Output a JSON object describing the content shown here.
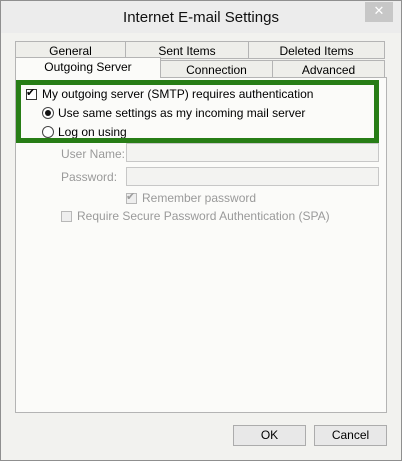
{
  "window": {
    "title": "Internet E-mail Settings"
  },
  "tabs": {
    "row_back": [
      {
        "label": "General"
      },
      {
        "label": "Sent Items"
      },
      {
        "label": "Deleted Items"
      }
    ],
    "row_front": [
      {
        "label": "Outgoing Server",
        "active": true
      },
      {
        "label": "Connection"
      },
      {
        "label": "Advanced"
      }
    ]
  },
  "outgoing": {
    "smtp_auth": {
      "label": "My outgoing server (SMTP) requires authentication",
      "checked": true
    },
    "same_settings": {
      "label": "Use same settings as my incoming mail server",
      "selected": true
    },
    "log_on": {
      "label": "Log on using",
      "selected": false
    },
    "username": {
      "label": "User Name:",
      "value": ""
    },
    "password": {
      "label": "Password:",
      "value": ""
    },
    "remember": {
      "label": "Remember password",
      "checked": true
    },
    "spa": {
      "label": "Require Secure Password Authentication (SPA)",
      "checked": false
    }
  },
  "buttons": {
    "ok": "OK",
    "cancel": "Cancel"
  },
  "colors": {
    "highlight": "#277d16"
  },
  "icons": {
    "close": "close-icon",
    "check": "checkmark-icon"
  }
}
